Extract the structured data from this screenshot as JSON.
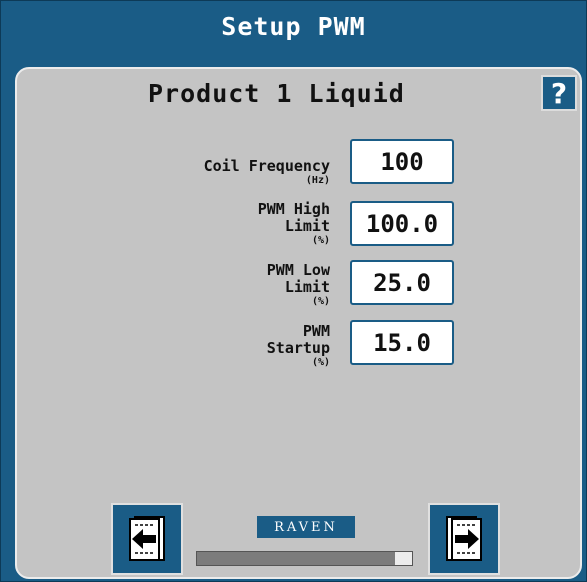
{
  "window": {
    "title": "Setup PWM"
  },
  "panel": {
    "heading": "Product 1 Liquid",
    "help_label": "?"
  },
  "fields": [
    {
      "label_lines": [
        "Coil Frequency"
      ],
      "unit": "(Hz)",
      "value": "100"
    },
    {
      "label_lines": [
        "PWM High",
        "Limit"
      ],
      "unit": "(%)",
      "value": "100.0"
    },
    {
      "label_lines": [
        "PWM Low",
        "Limit"
      ],
      "unit": "(%)",
      "value": "25.0"
    },
    {
      "label_lines": [
        "PWM",
        "Startup"
      ],
      "unit": "(%)",
      "value": "15.0"
    }
  ],
  "footer": {
    "logo_text": "RAVEN",
    "progress_fraction": 0.92,
    "back_icon": "page-back-arrow-icon",
    "next_icon": "page-forward-arrow-icon"
  },
  "colors": {
    "brand_blue": "#1a5c86",
    "panel_gray": "#c4c4c4"
  }
}
